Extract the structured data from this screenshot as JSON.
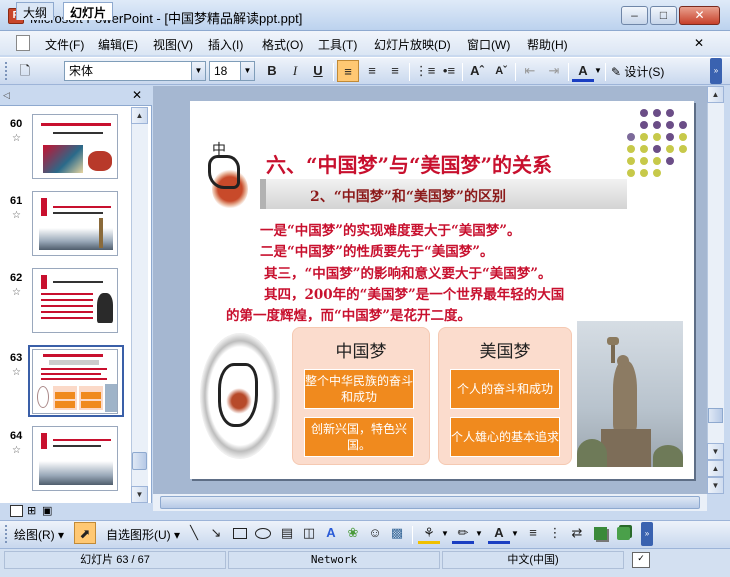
{
  "window": {
    "title": "Microsoft PowerPoint - [中国梦精品解读ppt.ppt]",
    "icon_label": "P"
  },
  "menu": [
    "文件(F)",
    "编辑(E)",
    "视图(V)",
    "插入(I)",
    "格式(O)",
    "工具(T)",
    "幻灯片放映(D)",
    "窗口(W)",
    "帮助(H)"
  ],
  "toolbar": {
    "font_name": "宋体",
    "font_size": "18",
    "bold": "B",
    "italic": "I",
    "underline": "U",
    "design_label": "设计(S)"
  },
  "left_pane": {
    "tabs": [
      "大纲",
      "幻灯片"
    ],
    "thumbnails": [
      {
        "number": "60"
      },
      {
        "number": "61"
      },
      {
        "number": "62"
      },
      {
        "number": "63"
      },
      {
        "number": "64"
      }
    ]
  },
  "slide": {
    "title": "六、“中国梦”与“美国梦”的关系",
    "subtitle": "2、“中国梦”和“美国梦”的区别",
    "lines": [
      "一是“中国梦”的实现难度要大于“美国梦”。",
      "二是“中国梦”的性质要先于“美国梦”。",
      "其三，“中国梦”的影响和意义要大于“美国梦”。",
      "其四，200年的“美国梦”是一个世界最年轻的大国",
      "的第一度辉煌，而“中国梦”是花开二度。"
    ],
    "china_dream": {
      "heading": "中国梦",
      "items": [
        "整个中华民族的奋斗和成功",
        "创新兴国，特色兴国。"
      ]
    },
    "american_dream": {
      "heading": "美国梦",
      "items": [
        "个人的奋斗和成功",
        "个人雄心的基本追求"
      ]
    },
    "calligraphy_char": "中"
  },
  "drawing_toolbar": {
    "draw_label": "绘图(R)",
    "autoshapes_label": "自选图形(U)"
  },
  "status": {
    "slide_indicator": "幻灯片 63 / 67",
    "theme": "Network",
    "language": "中文(中国)"
  },
  "colors": {
    "accent_red": "#c8102e",
    "orange": "#f08a1e",
    "office_blue": "#c9d9ef"
  }
}
